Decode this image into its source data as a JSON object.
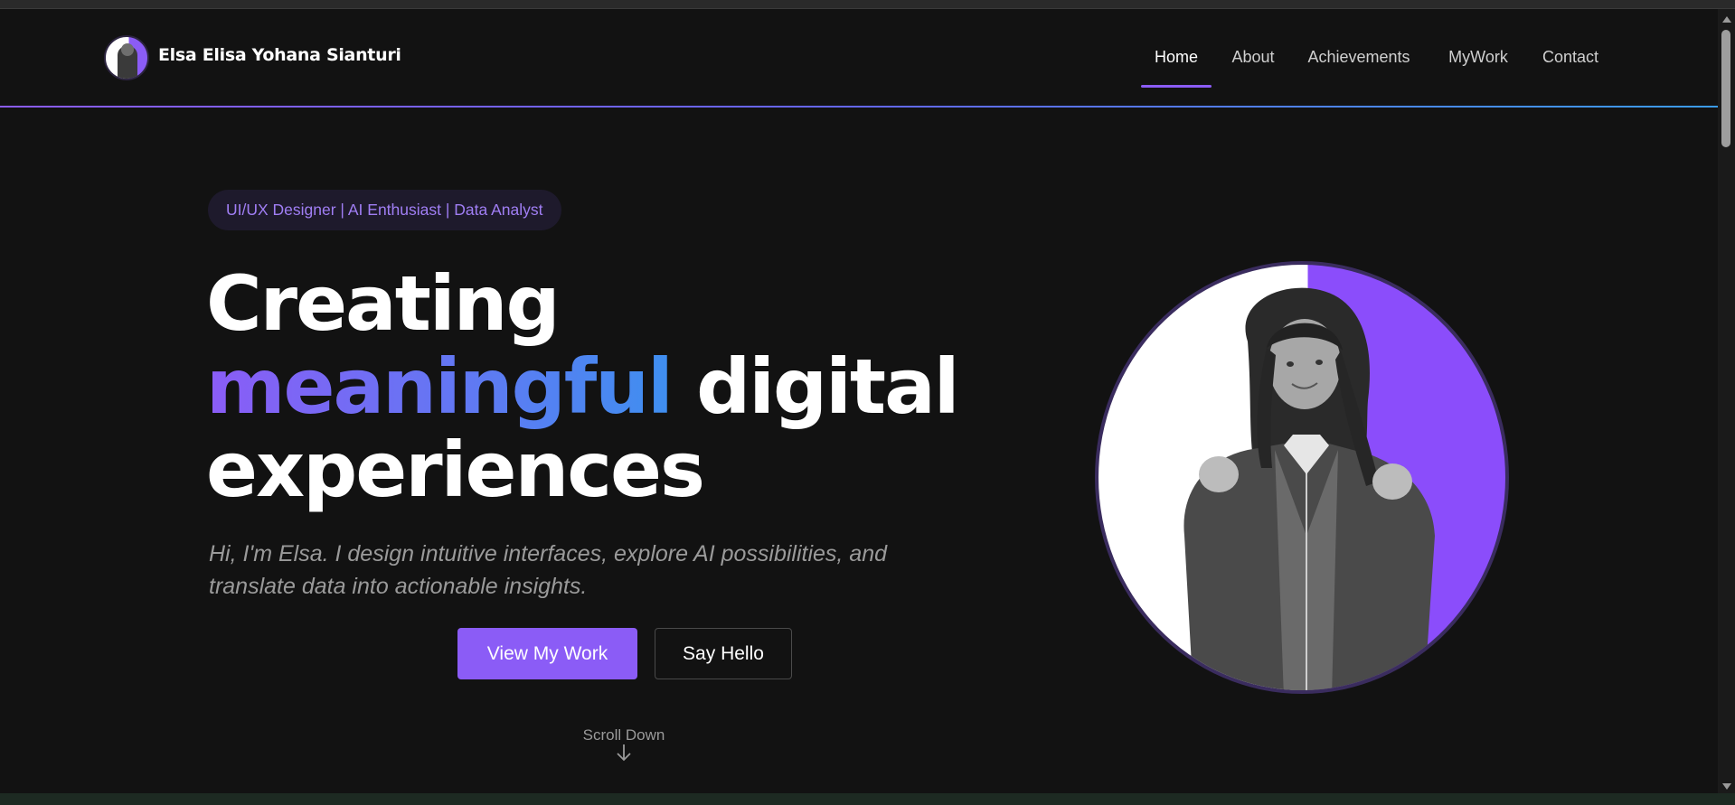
{
  "header": {
    "site_name": "Elsa Elisa Yohana Sianturi",
    "nav": [
      {
        "label": "Home",
        "active": true
      },
      {
        "label": "About"
      },
      {
        "label": "Achievements"
      },
      {
        "label": "MyWork"
      },
      {
        "label": "Contact"
      }
    ]
  },
  "hero": {
    "tagline": "UI/UX Designer | AI Enthusiast | Data Analyst",
    "headline": {
      "line1": "Creating",
      "highlight": "meaningful",
      "line2_rest": " digital",
      "line3": "experiences"
    },
    "intro": "Hi, I'm Elsa. I design intuitive interfaces, explore AI possibilities, and translate data into actionable insights.",
    "primary_button": "View My Work",
    "secondary_button": "Say Hello",
    "scroll_label": "Scroll Down"
  },
  "colors": {
    "accent": "#8b5cf6",
    "gradient_end": "#3f8ff0",
    "background": "#121212"
  },
  "icons": {
    "scroll": "arrow-down-icon",
    "avatar": "profile-avatar"
  }
}
